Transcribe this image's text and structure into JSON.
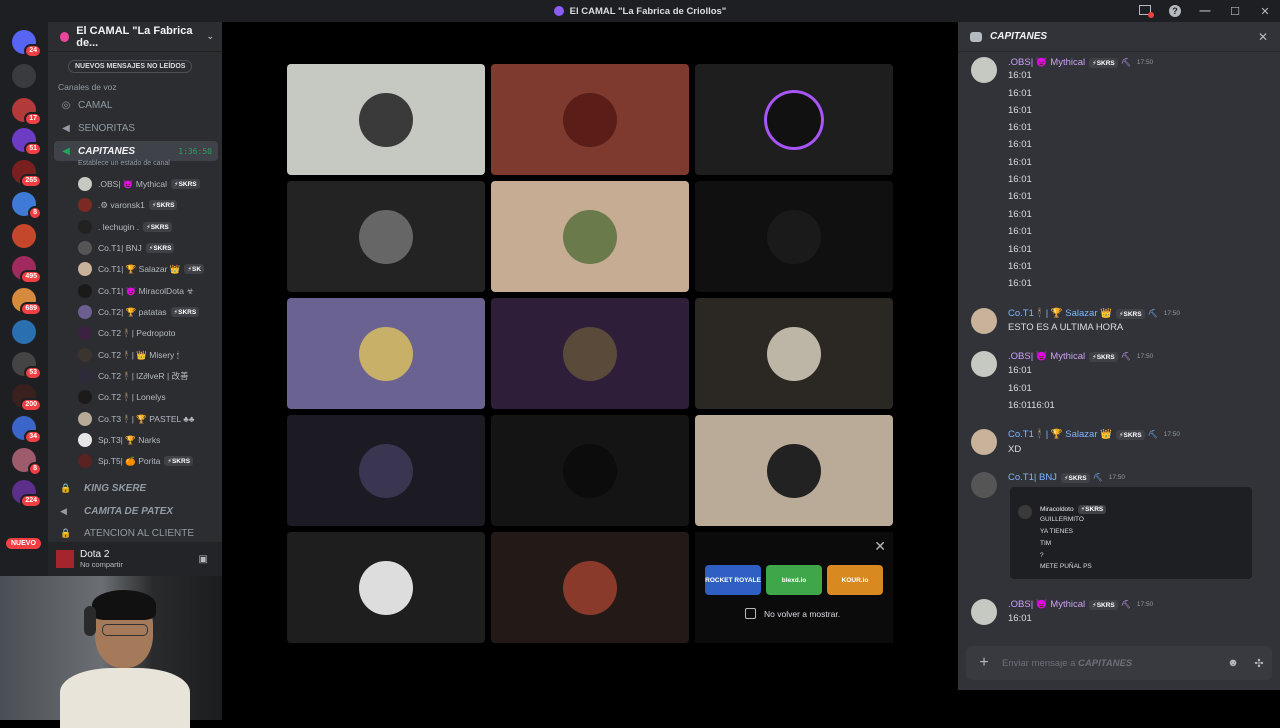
{
  "window": {
    "title": "El CAMAL \"La Fabrica de Criollos\""
  },
  "rail": {
    "badges": [
      "24",
      "17",
      "51",
      "265",
      "8",
      "495",
      "689",
      "53",
      "200",
      "34",
      "8",
      "224"
    ],
    "nuevo": "NUEVO"
  },
  "sidebar": {
    "server_name": "El CAMAL \"La Fabrica de...",
    "new_messages": "NUEVOS MENSAJES NO LEÍDOS",
    "category": "Canales de voz",
    "channels": {
      "camal": "CAMAL",
      "senoritas": "SENORITAS",
      "capitanes": "CAPITANES",
      "capitanes_timer": "1:36:50",
      "capitanes_status": "Establece un estado de canal",
      "kingskere": "KING SKERE",
      "camita": "CAMITA DE PATEX",
      "atencion": "ATENCION AL CLIENTE"
    },
    "members": [
      {
        "name": ".OBS| 👿 Mythical",
        "tag": "⚡SKRS"
      },
      {
        "name": ".⚙ varonsk1",
        "tag": "⚡SKRS"
      },
      {
        "name": ". lechugin .",
        "tag": "⚡SKRS"
      },
      {
        "name": "Co.T1| BNJ",
        "tag": "⚡SKRS"
      },
      {
        "name": "Co.T1| 🏆 Salazar 👑",
        "tag": "⚡SK"
      },
      {
        "name": "Co.T1| 👿 MiracolDota ☣",
        "tag": ""
      },
      {
        "name": "Co.T2| 🏆 patatas",
        "tag": "⚡SKRS"
      },
      {
        "name": "Co.T2🕴| Pedropoto",
        "tag": ""
      },
      {
        "name": "Co.T2🕴| 👑 Misery 🕯",
        "tag": ""
      },
      {
        "name": "Co.T2🕴| lZ∂lveR | 改善",
        "tag": ""
      },
      {
        "name": "Co.T2🕴| Lonelys",
        "tag": ""
      },
      {
        "name": "Co.T3🕴| 🏆 PASTEL ♣♣",
        "tag": ""
      },
      {
        "name": "Sp.T3| 🏆 Narks",
        "tag": ""
      },
      {
        "name": "Sp.T5| 🍊 Porita",
        "tag": "⚡SKRS"
      }
    ],
    "voice_status": {
      "game": "Dota 2",
      "status": "No compartir"
    }
  },
  "stage": {
    "promo": {
      "games": [
        "ROCKET ROYALE",
        "blexd.io",
        "KOUR.io"
      ],
      "checkbox_label": "No volver a mostrar."
    }
  },
  "chat": {
    "channel": "CAPITANES",
    "messages": [
      {
        "author": ".OBS| 👿 Mythical",
        "tag": "⚡SKRS",
        "time": "17:50",
        "lines": [
          "16:01",
          "16:01",
          "16:01",
          "16:01",
          "16:01",
          "16:01",
          "16:01",
          "16:01",
          "16:01",
          "16:01",
          "16:01",
          "16:01",
          "16:01"
        ]
      },
      {
        "author": "Co.T1🕴| 🏆 Salazar 👑",
        "tag": "⚡SKRS",
        "time": "17:50",
        "lines": [
          "ESTO ES A ULTIMA HORA"
        ]
      },
      {
        "author": ".OBS| 👿 Mythical",
        "tag": "⚡SKRS",
        "time": "17:50",
        "lines": [
          "16:01",
          "16:01",
          "16:0116:01"
        ]
      },
      {
        "author": "Co.T1🕴| 🏆 Salazar 👑",
        "tag": "⚡SKRS",
        "time": "17:50",
        "lines": [
          "XD"
        ]
      },
      {
        "author": "Co.T1| BNJ",
        "tag": "⚡SKRS",
        "time": "17:50",
        "lines": []
      },
      {
        "author": ".OBS| 👿 Mythical",
        "tag": "⚡SKRS",
        "time": "17:50",
        "lines": [
          "16:01"
        ]
      }
    ],
    "embed": {
      "author": "Miracoldoto",
      "tag": "⚡SKRS",
      "lines": [
        "GUILLERMITO",
        "YA TIENES",
        "TIM",
        "?",
        "METE PUÑAL PS"
      ]
    },
    "input_placeholder": "Enviar mensaje a",
    "input_channel": "CAPITANES"
  }
}
